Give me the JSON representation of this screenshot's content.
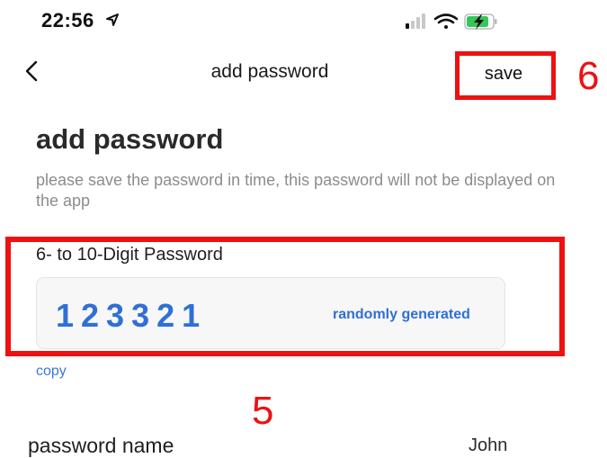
{
  "status_bar": {
    "time": "22:56",
    "icons": [
      "location-arrow-icon",
      "cellular-signal-icon",
      "wifi-icon",
      "battery-charging-icon"
    ]
  },
  "nav": {
    "back_icon": "chevron-left-icon",
    "title": "add password",
    "save_label": "save"
  },
  "page": {
    "heading": "add password",
    "subtitle": "please save the password in time, this password will not be displayed on the app"
  },
  "password": {
    "label": "6- to 10-Digit Password",
    "value": "123321",
    "random_label": "randomly generated",
    "copy_label": "copy"
  },
  "name_row": {
    "label": "password name",
    "value": "John"
  },
  "annotations": {
    "save_marker": "6",
    "password_marker": "5",
    "color": "#ee1111"
  },
  "colors": {
    "accent": "#2f6fd6",
    "battery_green": "#34c759",
    "annotation_red": "#ee1111"
  }
}
